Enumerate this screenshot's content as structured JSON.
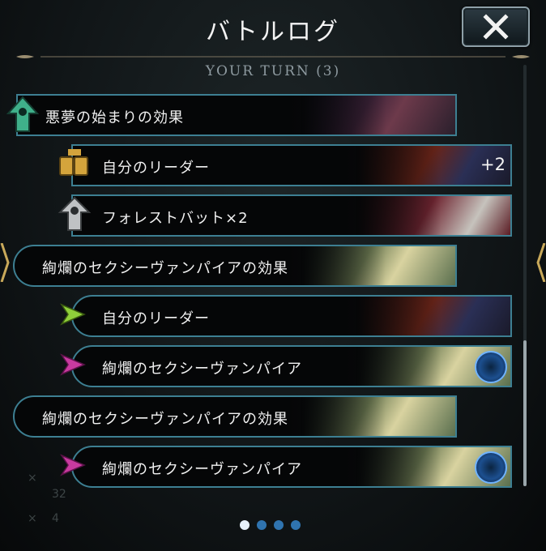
{
  "header": {
    "title": "バトルログ"
  },
  "turn_label": "YOUR TURN (3)",
  "entries": [
    {
      "label": "悪夢の始まりの効果",
      "icon": "amulet-up-icon",
      "value": ""
    },
    {
      "label": "自分のリーダー",
      "icon": "cards-icon",
      "value": "+2"
    },
    {
      "label": "フォレストバット×2",
      "icon": "summon-icon",
      "value": ""
    },
    {
      "label": "絢爛のセクシーヴァンパイアの効果",
      "icon": "",
      "value": ""
    },
    {
      "label": "自分のリーダー",
      "icon": "arrow-target-icon",
      "value": ""
    },
    {
      "label": "絢爛のセクシーヴァンパイア",
      "icon": "arrow-target-icon",
      "value": ""
    },
    {
      "label": "絢爛のセクシーヴァンパイアの効果",
      "icon": "",
      "value": ""
    },
    {
      "label": "絢爛のセクシーヴァンパイア",
      "icon": "arrow-target-icon",
      "value": ""
    }
  ],
  "background_text": [
    "×",
    "32",
    "×",
    "4"
  ],
  "pagination": {
    "pages": 4,
    "active": 1
  },
  "colors": {
    "border": "#3d7f92",
    "green": "#3fb08a",
    "gold": "#d4a43c",
    "lime": "#8fcf3a",
    "magenta": "#c83aa0"
  }
}
